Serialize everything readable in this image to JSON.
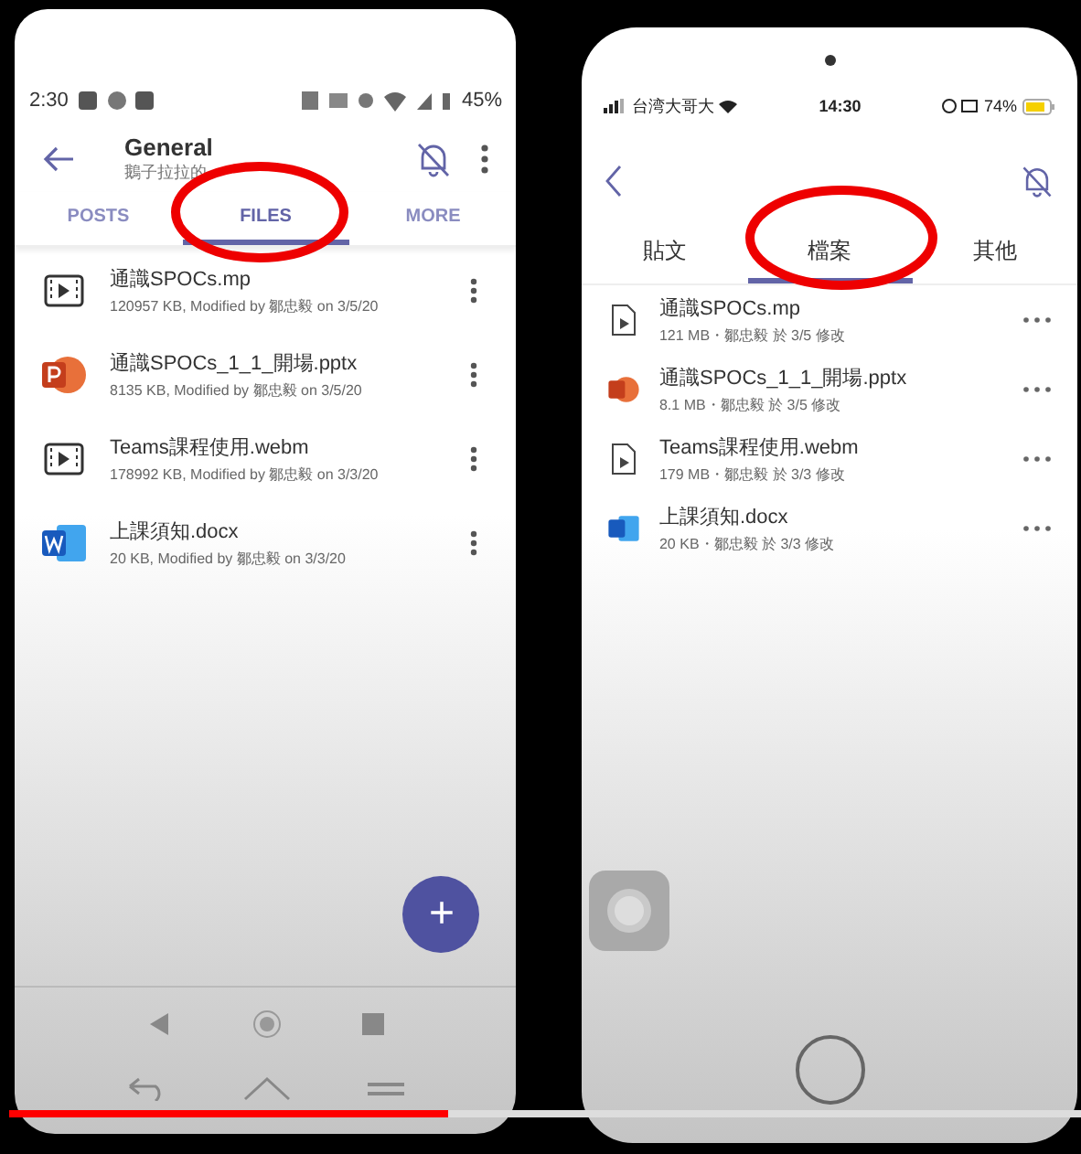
{
  "android": {
    "status": {
      "time": "2:30",
      "battery": "45%"
    },
    "title": "General",
    "subtitle": "鵝子拉拉的",
    "tabs": [
      {
        "label": "POSTS",
        "selected": false
      },
      {
        "label": "FILES",
        "selected": true
      },
      {
        "label": "MORE",
        "selected": false
      }
    ],
    "files": [
      {
        "kind": "video",
        "name": "通識SPOCs.mp",
        "meta": "120957 KB, Modified by 鄒忠毅 on 3/5/20"
      },
      {
        "kind": "powerpoint",
        "name": "通識SPOCs_1_1_開場.pptx",
        "meta": "8135 KB, Modified by 鄒忠毅 on 3/5/20"
      },
      {
        "kind": "video",
        "name": "Teams課程使用.webm",
        "meta": "178992 KB, Modified by 鄒忠毅 on 3/3/20"
      },
      {
        "kind": "word",
        "name": "上課須知.docx",
        "meta": "20 KB, Modified by 鄒忠毅 on 3/3/20"
      }
    ],
    "fab": "+"
  },
  "ios": {
    "status": {
      "carrier": "台湾大哥大",
      "time": "14:30",
      "battery": "74%"
    },
    "tabs": [
      {
        "label": "貼文",
        "selected": false
      },
      {
        "label": "檔案",
        "selected": true
      },
      {
        "label": "其他",
        "selected": false
      }
    ],
    "files": [
      {
        "kind": "video",
        "name": "通識SPOCs.mp",
        "meta": "121 MB・鄒忠毅 於 3/5 修改"
      },
      {
        "kind": "powerpoint",
        "name": "通識SPOCs_1_1_開場.pptx",
        "meta": "8.1 MB・鄒忠毅 於 3/5 修改"
      },
      {
        "kind": "video",
        "name": "Teams課程使用.webm",
        "meta": "179 MB・鄒忠毅 於 3/3 修改"
      },
      {
        "kind": "word",
        "name": "上課須知.docx",
        "meta": "20 KB・鄒忠毅 於 3/3 修改"
      }
    ]
  },
  "video_progress": {
    "level": 0.41
  }
}
